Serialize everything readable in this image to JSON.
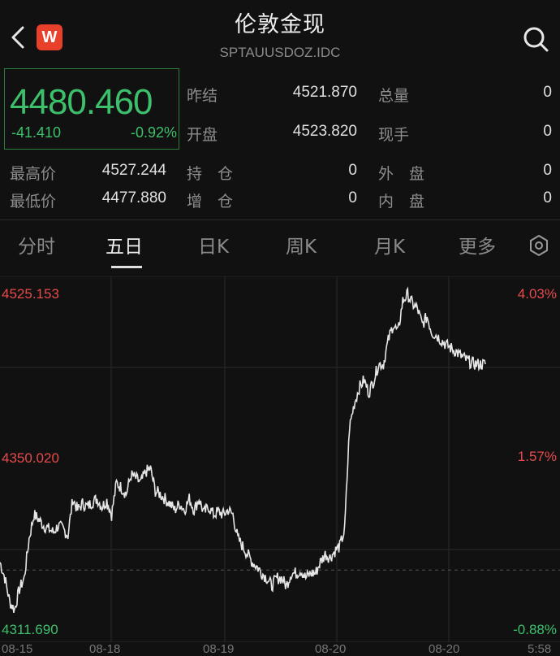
{
  "header": {
    "title": "伦敦金现",
    "code": "SPTAUUSDOZ.IDC",
    "logo_letter": "W",
    "back_icon": "chevron-left-icon",
    "search_icon": "search-icon"
  },
  "price": {
    "last": "4480.460",
    "change": "-41.410",
    "change_pct": "-0.92%",
    "color": "#3dc06c"
  },
  "quote": {
    "prev_close_label": "昨结",
    "prev_close": "4521.870",
    "open_label": "开盘",
    "open": "4523.820",
    "volume_label": "总量",
    "volume": "0",
    "current_hand_label": "现手",
    "current_hand": "0",
    "high_label": "最高价",
    "high": "4527.244",
    "low_label": "最低价",
    "low": "4477.880",
    "hold_label": "持　仓",
    "hold": "0",
    "add_label": "增　仓",
    "add": "0",
    "outer_label": "外　盘",
    "outer": "0",
    "inner_label": "内　盘",
    "inner": "0"
  },
  "tabs": [
    {
      "label": "分时",
      "active": false
    },
    {
      "label": "五日",
      "active": true
    },
    {
      "label": "日K",
      "active": false
    },
    {
      "label": "周K",
      "active": false
    },
    {
      "label": "月K",
      "active": false
    },
    {
      "label": "更多",
      "active": false
    }
  ],
  "chart_data": {
    "type": "line",
    "title": "",
    "y_left_ticks": [
      "4525.153",
      "4350.020",
      "4311.690"
    ],
    "y_right_ticks": [
      "4.03%",
      "1.57%",
      "-0.88%"
    ],
    "x_labels": [
      "08-15",
      "08-18",
      "08-19",
      "08-20",
      "08-20",
      "5:58"
    ],
    "ylim": [
      4311.69,
      4525.153
    ],
    "series": [
      {
        "x": [
          0,
          1,
          2,
          3,
          4,
          5,
          6,
          7,
          8,
          9,
          10,
          11,
          12,
          13,
          14,
          15,
          16,
          17,
          18,
          19,
          20,
          21,
          22,
          23,
          24,
          25,
          26,
          27,
          28,
          29,
          30,
          31,
          32,
          33,
          34,
          35,
          36,
          37,
          38,
          39,
          40,
          41,
          42,
          43,
          44,
          45,
          46,
          47,
          48,
          49,
          50,
          51,
          52,
          53,
          54,
          55,
          56,
          57,
          58,
          59,
          60,
          61,
          62,
          63,
          64,
          65,
          66,
          67,
          68,
          69,
          70,
          71,
          72,
          73,
          74,
          75,
          76,
          77,
          78,
          79,
          80,
          81,
          82,
          83,
          84,
          85,
          86,
          87,
          88,
          89,
          90,
          91,
          92,
          93,
          94,
          95,
          96,
          97,
          98,
          99,
          100
        ],
        "values": [
          4355,
          4345,
          4330,
          4325,
          4338,
          4345,
          4370,
          4385,
          4382,
          4378,
          4376,
          4374,
          4378,
          4376,
          4372,
          4395,
          4388,
          4392,
          4390,
          4393,
          4395,
          4390,
          4394,
          4385,
          4405,
          4402,
          4398,
          4410,
          4408,
          4405,
          4412,
          4414,
          4400,
          4398,
          4395,
          4392,
          4388,
          4392,
          4388,
          4395,
          4388,
          4395,
          4386,
          4390,
          4385,
          4387,
          4385,
          4388,
          4385,
          4370,
          4365,
          4360,
          4355,
          4352,
          4348,
          4345,
          4340,
          4345,
          4345,
          4340,
          4348,
          4348,
          4350,
          4345,
          4348,
          4348,
          4355,
          4360,
          4358,
          4362,
          4365,
          4375,
          4440,
          4455,
          4465,
          4470,
          4462,
          4470,
          4480,
          4480,
          4495,
          4505,
          4500,
          4520,
          4524,
          4518,
          4515,
          4505,
          4510,
          4500,
          4498,
          4495,
          4492,
          4490,
          4488,
          4485,
          4483,
          4481,
          4480,
          4480,
          4480
        ],
        "color": "#e6e6e6"
      }
    ],
    "ref_line": 4350.02
  }
}
